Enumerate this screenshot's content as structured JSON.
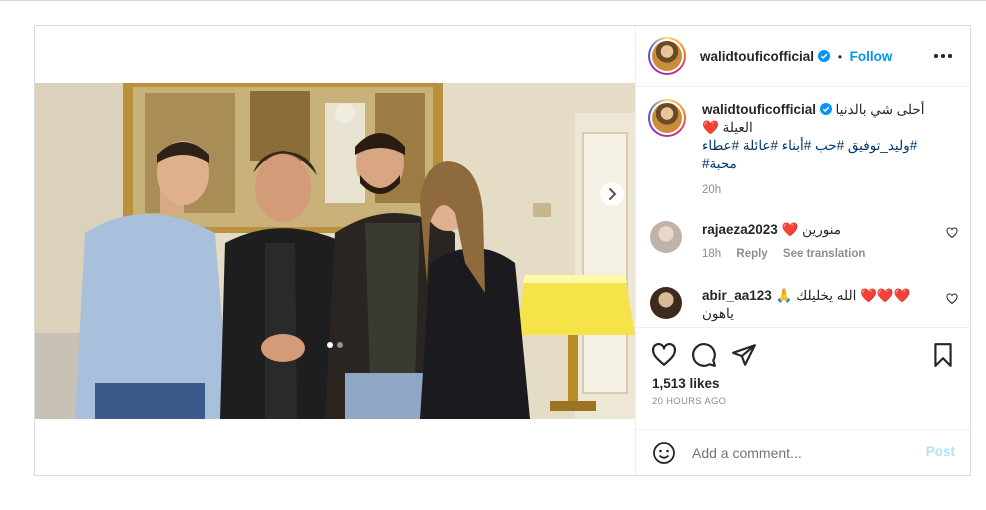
{
  "post": {
    "username": "walidtouficofficial",
    "separator": "•",
    "follow_label": "Follow",
    "caption_line1": "أحلى شي بالدنيا",
    "caption_line2": "العيلة",
    "caption_heart": "❤️",
    "hashtags_line1": "#وليد_توفيق #حب #أبناء #عائلة #عطاء",
    "hashtags_line2": "#محبة",
    "caption_time": "20h",
    "likes": "1,513 likes",
    "posted_ago": "20 HOURS AGO",
    "carousel": {
      "slides": 2,
      "current": 1
    }
  },
  "comments": [
    {
      "username": "rajaeza2023",
      "text": "منورين",
      "hearts": "❤️",
      "time": "18h",
      "reply_label": "Reply",
      "translate_label": "See translation"
    },
    {
      "username": "abir_aa123",
      "hearts": "❤️❤️❤️",
      "pray": "🙏",
      "text_line1": "الله يخليلك",
      "text_line2": "ياهون"
    }
  ],
  "add_comment": {
    "placeholder": "Add a comment...",
    "post_label": "Post"
  },
  "colors": {
    "accent": "#0095f6",
    "hashtag": "#00376b",
    "muted": "#8e8e8e",
    "heart": "#ed4956"
  },
  "icons": [
    "verified-badge-icon",
    "more-options-icon",
    "like-icon",
    "comment-icon",
    "share-icon",
    "save-icon",
    "emoji-icon",
    "next-slide-icon"
  ]
}
